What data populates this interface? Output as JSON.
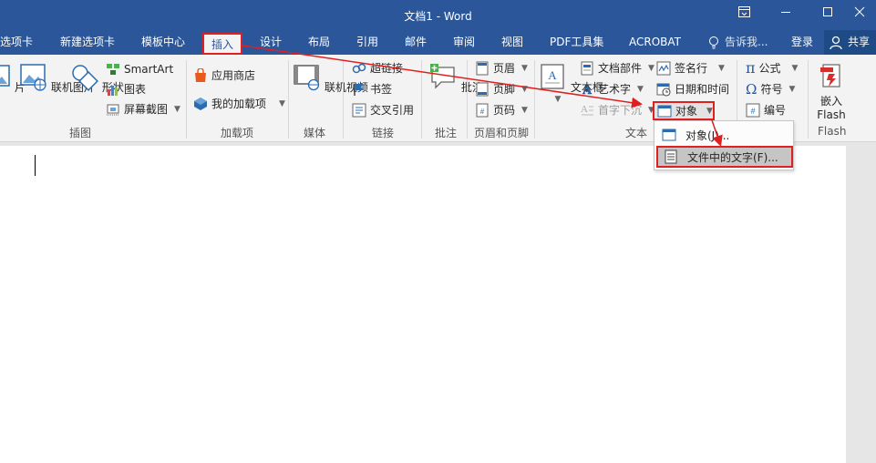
{
  "window": {
    "title": "文档1 - Word",
    "restore_icon": "ribbon-display-options-icon",
    "minimize_icon": "minimize-icon",
    "maximize_icon": "maximize-icon",
    "close_icon": "close-icon"
  },
  "tabs": [
    {
      "label": "选项卡"
    },
    {
      "label": "新建选项卡"
    },
    {
      "label": "模板中心"
    },
    {
      "label": "插入",
      "active": true
    },
    {
      "label": "设计"
    },
    {
      "label": "布局"
    },
    {
      "label": "引用"
    },
    {
      "label": "邮件"
    },
    {
      "label": "审阅"
    },
    {
      "label": "视图"
    },
    {
      "label": "PDF工具集"
    },
    {
      "label": "ACROBAT"
    }
  ],
  "tellme": {
    "placeholder": "告诉我...",
    "icon": "lightbulb-icon"
  },
  "login": "登录",
  "share": {
    "label": "共享",
    "icon": "person-icon"
  },
  "ribbon": {
    "illustrations": {
      "label": "插图",
      "pictures_partial": "片",
      "online_pictures": "联机图片",
      "shapes": "形状",
      "smartart": "SmartArt",
      "chart": "图表",
      "screenshot": "屏幕截图"
    },
    "addins": {
      "label": "加载项",
      "store": "应用商店",
      "my_addins": "我的加载项"
    },
    "media": {
      "label": "媒体",
      "online_video": "联机视频"
    },
    "links": {
      "label": "链接",
      "hyperlink": "超链接",
      "bookmark": "书签",
      "cross_reference": "交叉引用"
    },
    "comments": {
      "label": "批注",
      "comment": "批注"
    },
    "header_footer": {
      "label": "页眉和页脚",
      "header": "页眉",
      "footer": "页脚",
      "page_number": "页码"
    },
    "text": {
      "label": "文本",
      "text_box": "文本框",
      "quick_parts": "文档部件",
      "wordart": "艺术字",
      "drop_cap": "首字下沉",
      "signature_line": "签名行",
      "date_time": "日期和时间",
      "object": "对象"
    },
    "symbols": {
      "equation": "公式",
      "symbol": "符号",
      "number": "编号"
    },
    "flash": {
      "label": "Flash",
      "embed_line1": "嵌入",
      "embed_line2": "Flash"
    }
  },
  "object_menu": {
    "items": [
      {
        "label": "对象(J)...",
        "icon": "object-window-icon"
      },
      {
        "label": "文件中的文字(F)...",
        "icon": "text-file-icon",
        "selected": true
      }
    ]
  },
  "colors": {
    "brand": "#2b579a",
    "highlight": "#e02020"
  }
}
